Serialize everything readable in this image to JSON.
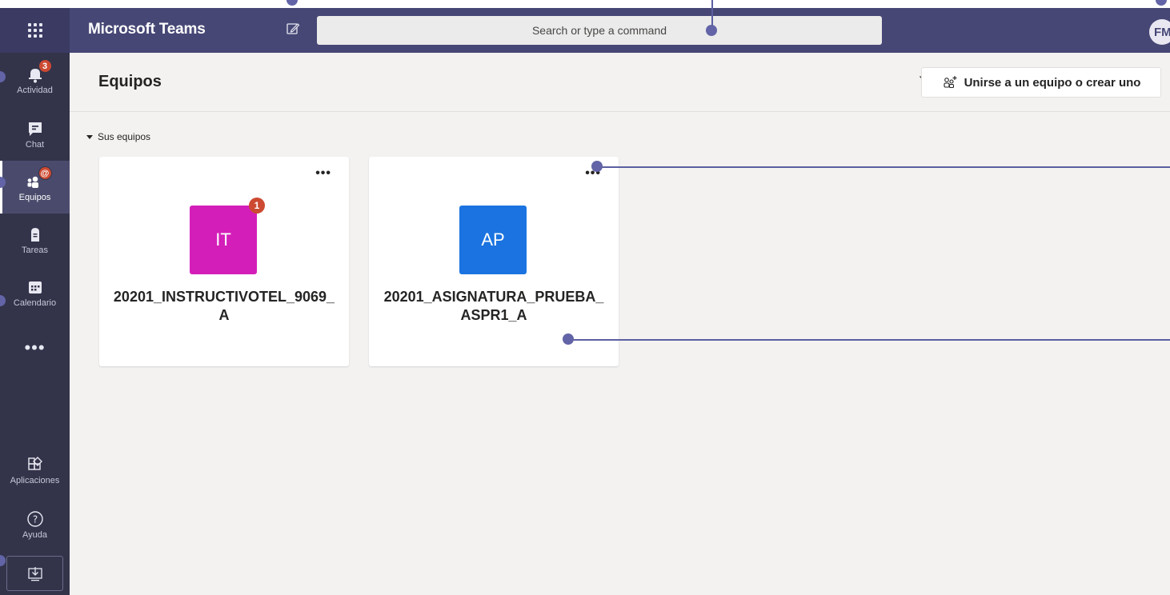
{
  "topbar": {
    "app_name": "Microsoft Teams",
    "search_placeholder": "Search or type a command",
    "user_initials": "FM"
  },
  "rail": {
    "items": [
      {
        "label": "Actividad",
        "icon": "bell-icon",
        "badge": "3"
      },
      {
        "label": "Chat",
        "icon": "chat-icon"
      },
      {
        "label": "Equipos",
        "icon": "teams-icon",
        "badge": "@"
      },
      {
        "label": "Tareas",
        "icon": "assignments-icon"
      },
      {
        "label": "Calendario",
        "icon": "calendar-icon"
      },
      {
        "label": "Aplicaciones",
        "icon": "apps-icon"
      },
      {
        "label": "Ayuda",
        "icon": "help-icon"
      }
    ],
    "more_label": "•••",
    "active": "Equipos"
  },
  "header": {
    "title": "Equipos",
    "join_button_label": "Unirse a un equipo o crear uno"
  },
  "section": {
    "label": "Sus equipos"
  },
  "teams": [
    {
      "initials": "IT",
      "name": "20201_INSTRUCTIVOTEL_9069_A",
      "color": "#d41eb9",
      "badge": "1",
      "more": "•••"
    },
    {
      "initials": "AP",
      "name": "20201_ASIGNATURA_PRUEBA_ASPR1_A",
      "color": "#1a73e0",
      "more": "•••"
    }
  ],
  "colors": {
    "topbar": "#464775",
    "rail": "#33344a",
    "background": "#f3f2f1",
    "badge": "#cc4a31",
    "annotation": "#6264a7"
  }
}
